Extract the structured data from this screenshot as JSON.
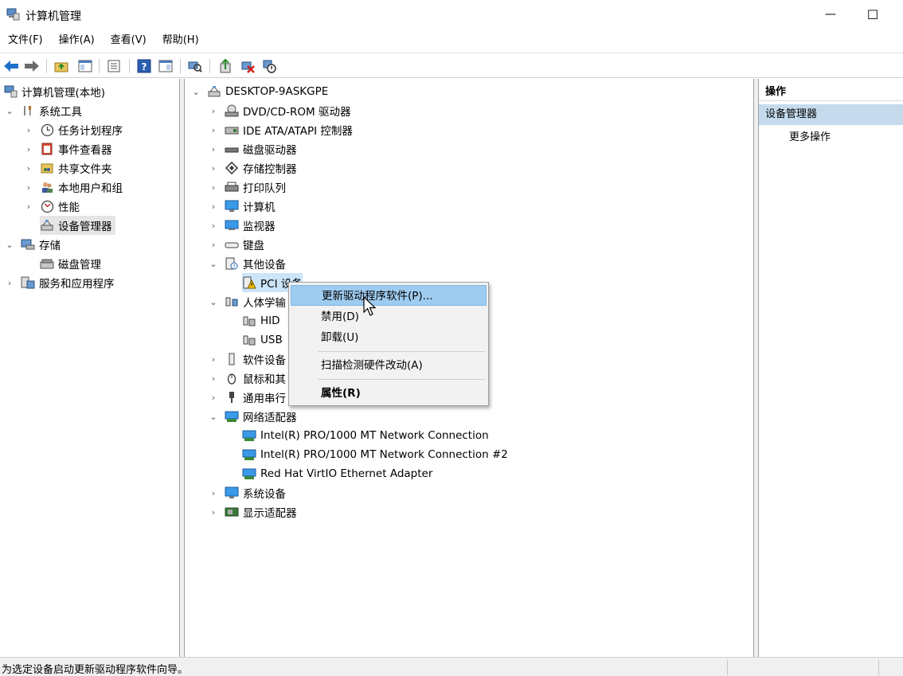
{
  "window": {
    "title": "计算机管理",
    "minimize": "—",
    "maximize": "☐"
  },
  "menu": [
    {
      "label": "文件(F)"
    },
    {
      "label": "操作(A)"
    },
    {
      "label": "查看(V)"
    },
    {
      "label": "帮助(H)"
    }
  ],
  "left_tree": {
    "root": "计算机管理(本地)",
    "system_tools": "系统工具",
    "task_scheduler": "任务计划程序",
    "event_viewer": "事件查看器",
    "shared_folders": "共享文件夹",
    "local_users": "本地用户和组",
    "performance": "性能",
    "device_manager": "设备管理器",
    "storage": "存储",
    "disk_management": "磁盘管理",
    "services_apps": "服务和应用程序"
  },
  "device_tree": {
    "computer": "DESKTOP-9ASKGPE",
    "dvd": "DVD/CD-ROM 驱动器",
    "ide": "IDE ATA/ATAPI 控制器",
    "disk": "磁盘驱动器",
    "storage_ctrl": "存储控制器",
    "print_queue": "打印队列",
    "computer_node": "计算机",
    "monitor": "监视器",
    "keyboard": "键盘",
    "other_devices": "其他设备",
    "pci_device": "PCI 设备",
    "hid_group": "人体学输",
    "hid": "HID",
    "usb": "USB",
    "software_dev": "软件设备",
    "mouse": "鼠标和其",
    "serial": "通用串行",
    "network": "网络适配器",
    "nic1": "Intel(R) PRO/1000 MT Network Connection",
    "nic2": "Intel(R) PRO/1000 MT Network Connection #2",
    "nic3": "Red Hat VirtIO Ethernet Adapter",
    "system_dev": "系统设备",
    "display": "显示适配器"
  },
  "context_menu": {
    "update_driver": "更新驱动程序软件(P)...",
    "disable": "禁用(D)",
    "uninstall": "卸载(U)",
    "scan": "扫描检测硬件改动(A)",
    "properties": "属性(R)"
  },
  "actions": {
    "header": "操作",
    "section": "设备管理器",
    "more": "更多操作"
  },
  "status": {
    "text": "为选定设备启动更新驱动程序软件向导。"
  },
  "colors": {
    "highlight": "#9ecbf0",
    "action_section": "#c5dbed",
    "arrow_blue": "#1e6fc9"
  }
}
